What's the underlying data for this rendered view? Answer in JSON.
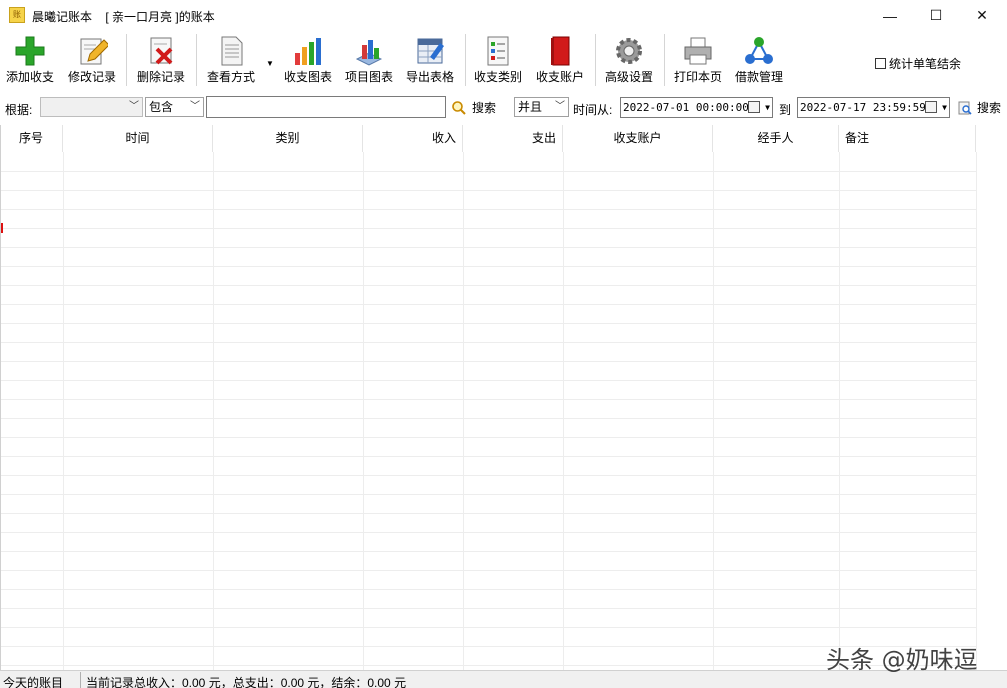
{
  "window": {
    "app_name": "晨曦记账本",
    "book_title": "[ 亲一口月亮 ]的账本",
    "controls": {
      "minimize": "—",
      "maximize": "☐",
      "close": "✕"
    }
  },
  "toolbar": {
    "buttons": [
      {
        "label": "添加收支",
        "icon": "add-icon"
      },
      {
        "label": "修改记录",
        "icon": "edit-pencil-icon"
      },
      {
        "label": "删除记录",
        "icon": "delete-icon"
      },
      {
        "label": "查看方式",
        "icon": "document-icon"
      },
      {
        "label": "收支图表",
        "icon": "bar-chart-icon"
      },
      {
        "label": "项目图表",
        "icon": "3d-chart-icon"
      },
      {
        "label": "导出表格",
        "icon": "export-sheet-icon"
      },
      {
        "label": "收支类别",
        "icon": "checklist-icon"
      },
      {
        "label": "收支账户",
        "icon": "book-icon"
      },
      {
        "label": "高级设置",
        "icon": "gear-icon"
      },
      {
        "label": "打印本页",
        "icon": "printer-icon"
      },
      {
        "label": "借款管理",
        "icon": "network-icon"
      }
    ],
    "view_dropdown": "▼",
    "stat_single": {
      "label": "统计单笔结余",
      "checked": false
    }
  },
  "search": {
    "basis_label": "根据:",
    "basis_value": "",
    "match_value": "包含",
    "keyword": "",
    "search_label": "搜索",
    "logic_value": "并且",
    "time_from_label": "时间从:",
    "time_from": "2022-07-01 00:00:00",
    "to_label": "到",
    "time_to": "2022-07-17 23:59:59",
    "search2_label": "搜索"
  },
  "grid": {
    "columns": [
      "序号",
      "时间",
      "类别",
      "收入",
      "支出",
      "收支账户",
      "经手人",
      "备注"
    ],
    "rows": []
  },
  "status": {
    "today_label": "今天的账目",
    "summary": "当前记录总收入：0.00 元，总支出：0.00 元，结余：0.00 元"
  },
  "watermark": "头条 @奶味逗",
  "colors": {
    "accent_red": "#d11a1a",
    "grid_line": "#ededed"
  }
}
